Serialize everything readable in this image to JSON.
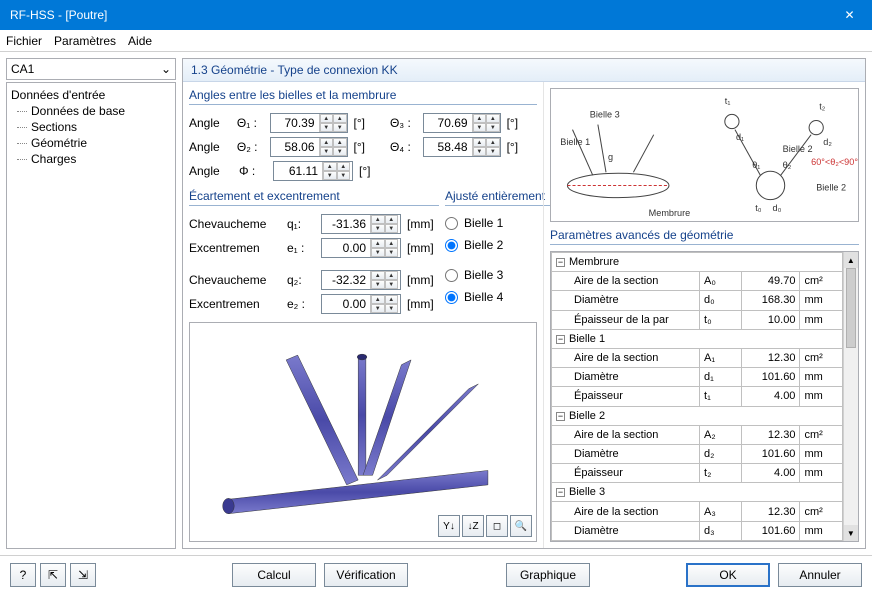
{
  "window": {
    "title": "RF-HSS - [Poutre]",
    "close": "✕"
  },
  "menu": {
    "file": "Fichier",
    "params": "Paramètres",
    "help": "Aide"
  },
  "combo": {
    "value": "CA1"
  },
  "tree": {
    "root": "Données d'entrée",
    "items": [
      "Données de base",
      "Sections",
      "Géométrie",
      "Charges"
    ]
  },
  "panel": {
    "header": "1.3 Géométrie - Type de connexion KK"
  },
  "angles": {
    "title": "Angles entre les bielles et la membrure",
    "label_angle": "Angle",
    "theta1": "Θ₁ :",
    "v1": "70.39",
    "u1": "[°]",
    "theta2": "Θ₂ :",
    "v2": "58.06",
    "u2": "[°]",
    "phi": "Φ :",
    "v3": "61.11",
    "u3": "[°]",
    "theta3": "Θ₃ :",
    "v4": "70.69",
    "u4": "[°]",
    "theta4": "Θ₄ :",
    "v5": "58.48",
    "u5": "[°]"
  },
  "gap": {
    "title": "Écartement et excentrement",
    "r1l": "Chevaucheme",
    "r1s": "q₁:",
    "r1v": "-31.36",
    "u": "[mm]",
    "r2l": "Excentremen",
    "r2s": "e₁ :",
    "r2v": "0.00",
    "r3l": "Chevaucheme",
    "r3s": "q₂:",
    "r3v": "-32.32",
    "r4l": "Excentremen",
    "r4s": "e₂ :",
    "r4v": "0.00"
  },
  "adjust": {
    "title": "Ajusté entièrement",
    "o1": "Bielle 1",
    "o2": "Bielle 2",
    "o3": "Bielle 3",
    "o4": "Bielle 4"
  },
  "advparams": {
    "title": "Paramètres avancés de géométrie",
    "rows": [
      {
        "type": "grp",
        "label": "Membrure"
      },
      {
        "label": "Aire de la section",
        "sym": "A₀",
        "val": "49.70",
        "unit": "cm²"
      },
      {
        "label": "Diamètre",
        "sym": "d₀",
        "val": "168.30",
        "unit": "mm"
      },
      {
        "label": "Épaisseur de la par",
        "sym": "t₀",
        "val": "10.00",
        "unit": "mm"
      },
      {
        "type": "grp",
        "label": "Bielle 1"
      },
      {
        "label": "Aire de la section",
        "sym": "A₁",
        "val": "12.30",
        "unit": "cm²"
      },
      {
        "label": "Diamètre",
        "sym": "d₁",
        "val": "101.60",
        "unit": "mm"
      },
      {
        "label": "Épaisseur",
        "sym": "t₁",
        "val": "4.00",
        "unit": "mm"
      },
      {
        "type": "grp",
        "label": "Bielle 2"
      },
      {
        "label": "Aire de la section",
        "sym": "A₂",
        "val": "12.30",
        "unit": "cm²"
      },
      {
        "label": "Diamètre",
        "sym": "d₂",
        "val": "101.60",
        "unit": "mm"
      },
      {
        "label": "Épaisseur",
        "sym": "t₂",
        "val": "4.00",
        "unit": "mm"
      },
      {
        "type": "grp",
        "label": "Bielle 3"
      },
      {
        "label": "Aire de la section",
        "sym": "A₃",
        "val": "12.30",
        "unit": "cm²"
      },
      {
        "label": "Diamètre",
        "sym": "d₃",
        "val": "101.60",
        "unit": "mm"
      }
    ]
  },
  "diagram_labels": {
    "b1": "Bielle 1",
    "b2": "Bielle 2",
    "b3": "Bielle 3",
    "memb": "Membrure",
    "t1": "t₁",
    "t2": "t₂",
    "d1": "d₁",
    "d2": "d₂",
    "d0": "d₀",
    "t0": "t₀",
    "g": "g",
    "th1": "θ₁",
    "th2": "θ₂",
    "range": "60°<θ₂<90°"
  },
  "viz_toolbar": {
    "b1": "Y↓",
    "b2": "↓Z",
    "b3": "◻",
    "b4": "🔍"
  },
  "footer": {
    "calc": "Calcul",
    "verif": "Vérification",
    "graph": "Graphique",
    "ok": "OK",
    "cancel": "Annuler",
    "i1": "?",
    "i2": "⇱",
    "i3": "⇲"
  }
}
